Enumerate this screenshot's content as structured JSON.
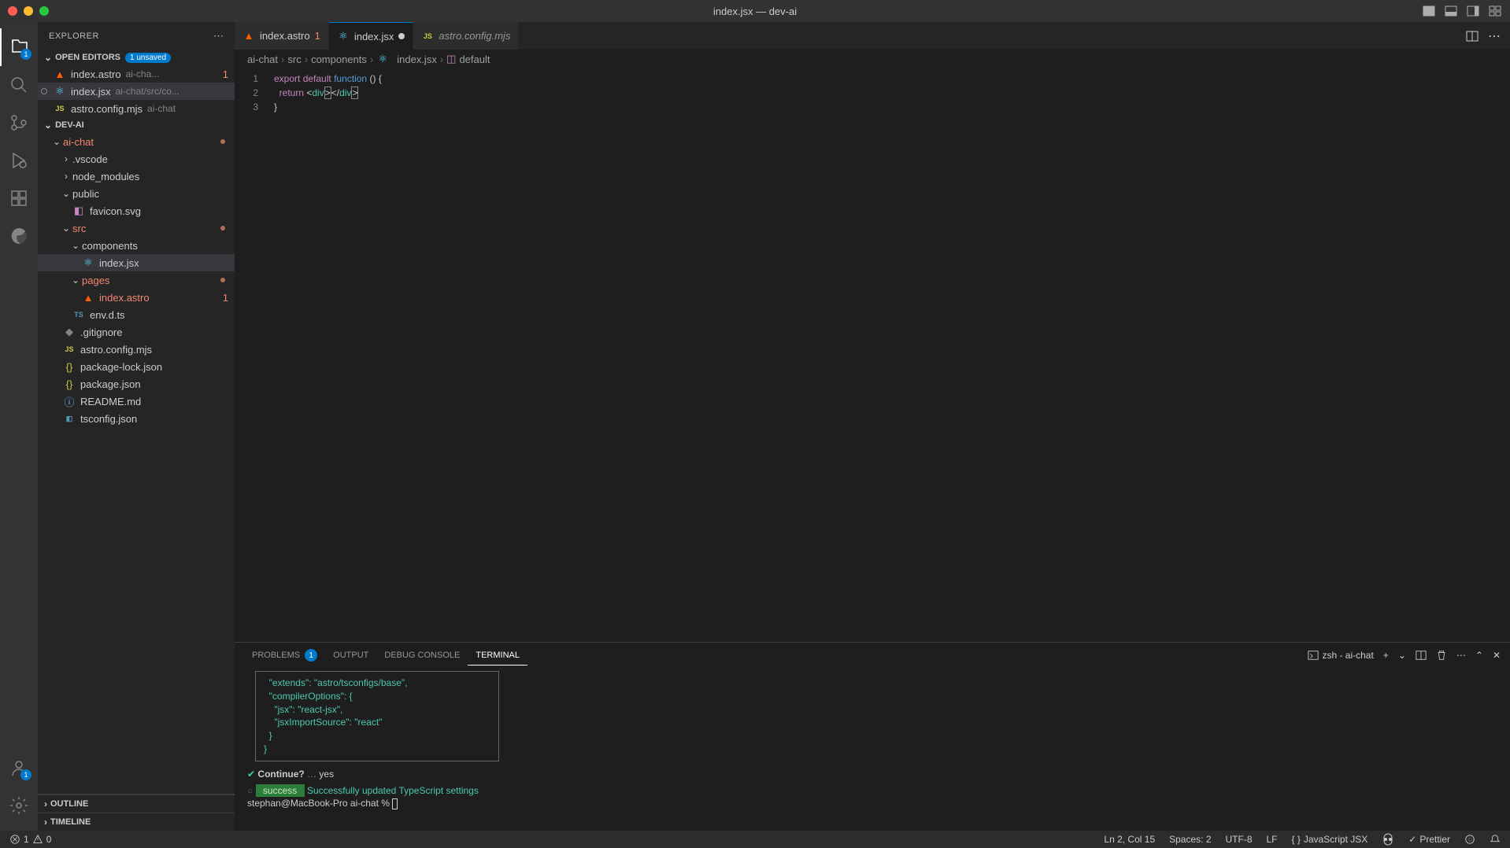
{
  "titlebar": {
    "title": "index.jsx — dev-ai"
  },
  "sidebar": {
    "title": "EXPLORER",
    "openEditors": {
      "label": "OPEN EDITORS",
      "badge": "1 unsaved",
      "items": [
        {
          "name": "index.astro",
          "path": "ai-cha...",
          "error": "1"
        },
        {
          "name": "index.jsx",
          "path": "ai-chat/src/co..."
        },
        {
          "name": "astro.config.mjs",
          "path": "ai-chat"
        }
      ]
    },
    "workspace": {
      "label": "DEV-AI",
      "tree": {
        "ai_chat": "ai-chat",
        "vscode": ".vscode",
        "node_modules": "node_modules",
        "public": "public",
        "favicon": "favicon.svg",
        "src": "src",
        "components": "components",
        "index_jsx": "index.jsx",
        "pages": "pages",
        "index_astro": "index.astro",
        "index_astro_err": "1",
        "env_dts": "env.d.ts",
        "gitignore": ".gitignore",
        "astro_config": "astro.config.mjs",
        "pkg_lock": "package-lock.json",
        "pkg": "package.json",
        "readme": "README.md",
        "tsconfig": "tsconfig.json"
      }
    },
    "outline": "OUTLINE",
    "timeline": "TIMELINE"
  },
  "activityBar": {
    "explorerBadge": "1",
    "accountBadge": "1"
  },
  "tabs": [
    {
      "name": "index.astro",
      "error": "1"
    },
    {
      "name": "index.jsx"
    },
    {
      "name": "astro.config.mjs"
    }
  ],
  "breadcrumbs": {
    "parts": [
      "ai-chat",
      "src",
      "components",
      "index.jsx",
      "default"
    ]
  },
  "editor": {
    "lines": [
      "1",
      "2",
      "3"
    ],
    "line1_kw_export": "export",
    "line1_kw_default": "default",
    "line1_kw_function": "function",
    "line1_rest": " () {",
    "line2_indent": "  ",
    "line2_return": "return",
    "line2_tag_open": " <",
    "line2_div1": "div",
    "line2_close1": ">",
    "line2_lt": "<",
    "line2_slash": "/",
    "line2_div2": "div",
    "line2_close2": ">",
    "line3": "}"
  },
  "panel": {
    "tabs": {
      "problems": "PROBLEMS",
      "problemsBadge": "1",
      "output": "OUTPUT",
      "debug": "DEBUG CONSOLE",
      "terminal": "TERMINAL"
    },
    "terminalLabel": "zsh - ai-chat",
    "json": {
      "l1": "  \"extends\": \"astro/tsconfigs/base\",",
      "l2": "  \"compilerOptions\": {",
      "l3": "    \"jsx\": \"react-jsx\",",
      "l4": "    \"jsxImportSource\": \"react\"",
      "l5": "  }",
      "l6": "}"
    },
    "continueLabel": "Continue?",
    "continueDots": " … ",
    "continueAnswer": "yes",
    "successBadge": " success ",
    "successText": " Successfully updated TypeScript settings",
    "prompt": "stephan@MacBook-Pro ai-chat % "
  },
  "statusbar": {
    "errors": "1",
    "warnings": "0",
    "lnCol": "Ln 2, Col 15",
    "spaces": "Spaces: 2",
    "encoding": "UTF-8",
    "eol": "LF",
    "lang": "JavaScript JSX",
    "prettier": "Prettier"
  }
}
